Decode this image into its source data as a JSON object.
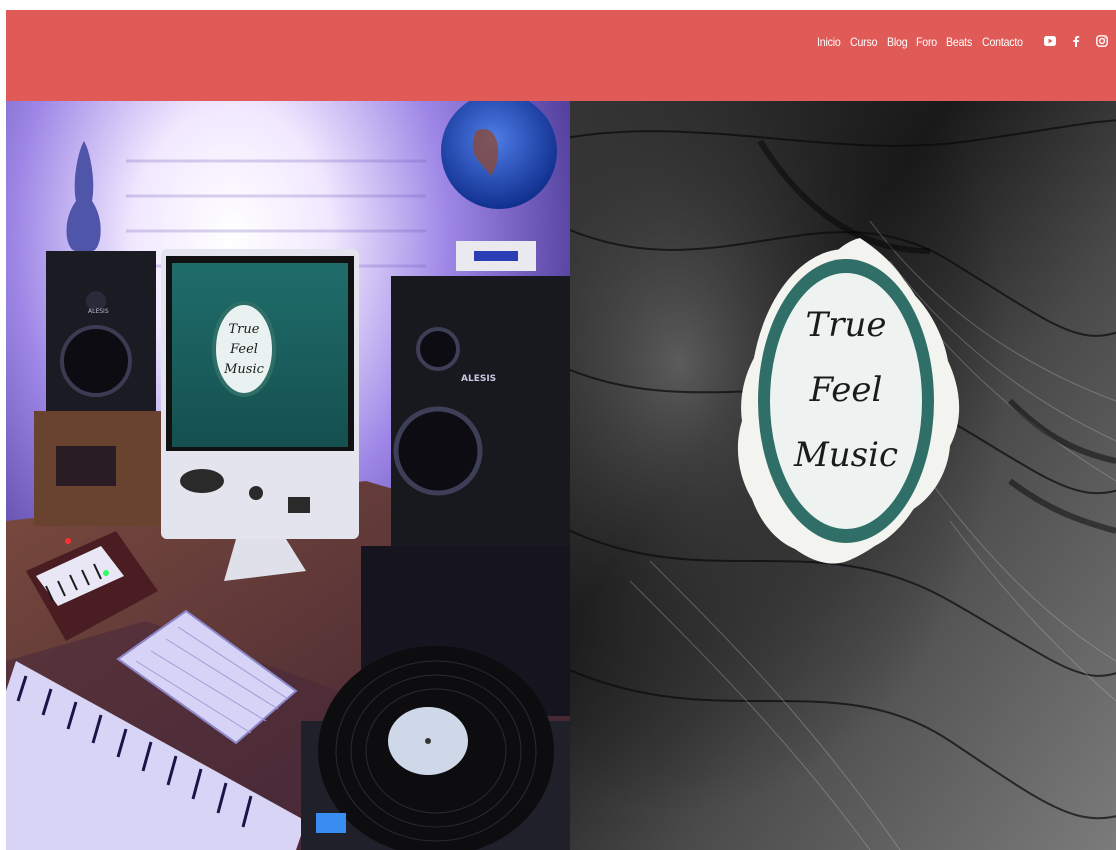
{
  "nav": {
    "items": [
      {
        "label": "Inicio"
      },
      {
        "label": "Curso"
      },
      {
        "label": "Blog"
      },
      {
        "label": "Foro"
      },
      {
        "label": "Beats"
      },
      {
        "label": "Contacto"
      }
    ]
  },
  "social": {
    "icons": [
      "youtube-icon",
      "facebook-icon",
      "instagram-icon"
    ]
  },
  "brand": {
    "line1": "True",
    "line2": "Feel",
    "line3": "Music",
    "badge_color": "#2f6f68"
  },
  "colors": {
    "header_bg": "#e05a57",
    "nav_text": "#ffffff"
  }
}
